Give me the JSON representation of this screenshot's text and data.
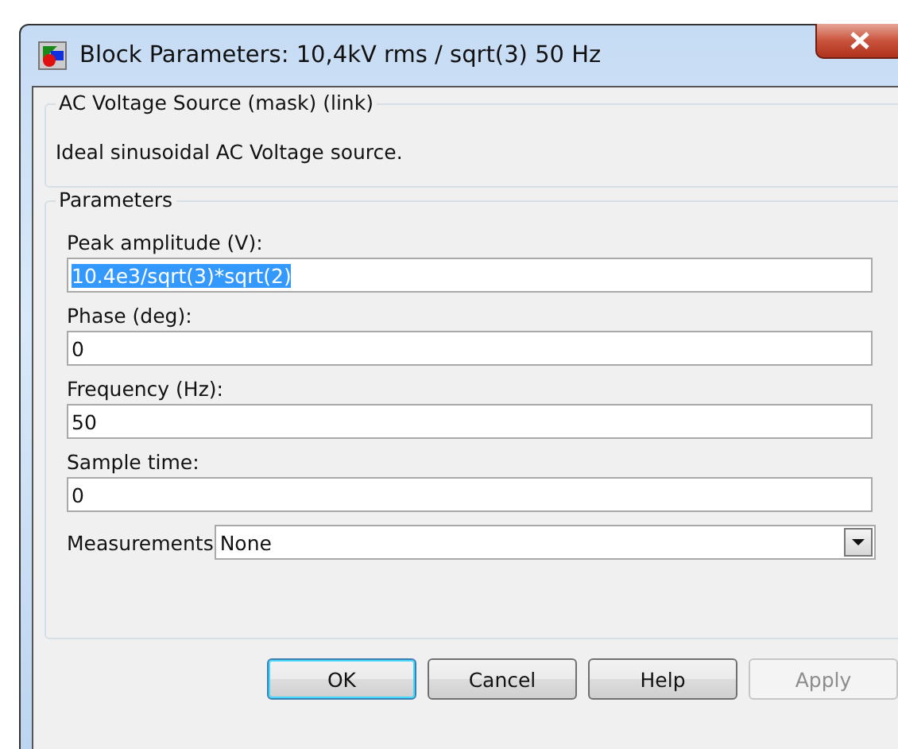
{
  "window": {
    "title": "Block Parameters: 10,4kV rms / sqrt(3) 50 Hz"
  },
  "description": {
    "title": "AC Voltage Source (mask) (link)",
    "text": "Ideal sinusoidal AC Voltage source."
  },
  "parameters": {
    "title": "Parameters",
    "fields": [
      {
        "kind": "text",
        "label": "Peak amplitude (V):",
        "value": "10.4e3/sqrt(3)*sqrt(2)",
        "highlighted": true
      },
      {
        "kind": "text",
        "label": "Phase (deg):",
        "value": "0",
        "highlighted": false
      },
      {
        "kind": "text",
        "label": "Frequency (Hz):",
        "value": "50",
        "highlighted": false
      },
      {
        "kind": "text",
        "label": "Sample time:",
        "value": "0",
        "highlighted": false
      },
      {
        "kind": "select",
        "label": "Measurements",
        "value": "None",
        "highlighted": false
      }
    ]
  },
  "buttons": [
    {
      "label": "OK",
      "default": true,
      "disabled": false
    },
    {
      "label": "Cancel",
      "default": false,
      "disabled": false
    },
    {
      "label": "Help",
      "default": false,
      "disabled": false
    },
    {
      "label": "Apply",
      "default": false,
      "disabled": true
    }
  ]
}
